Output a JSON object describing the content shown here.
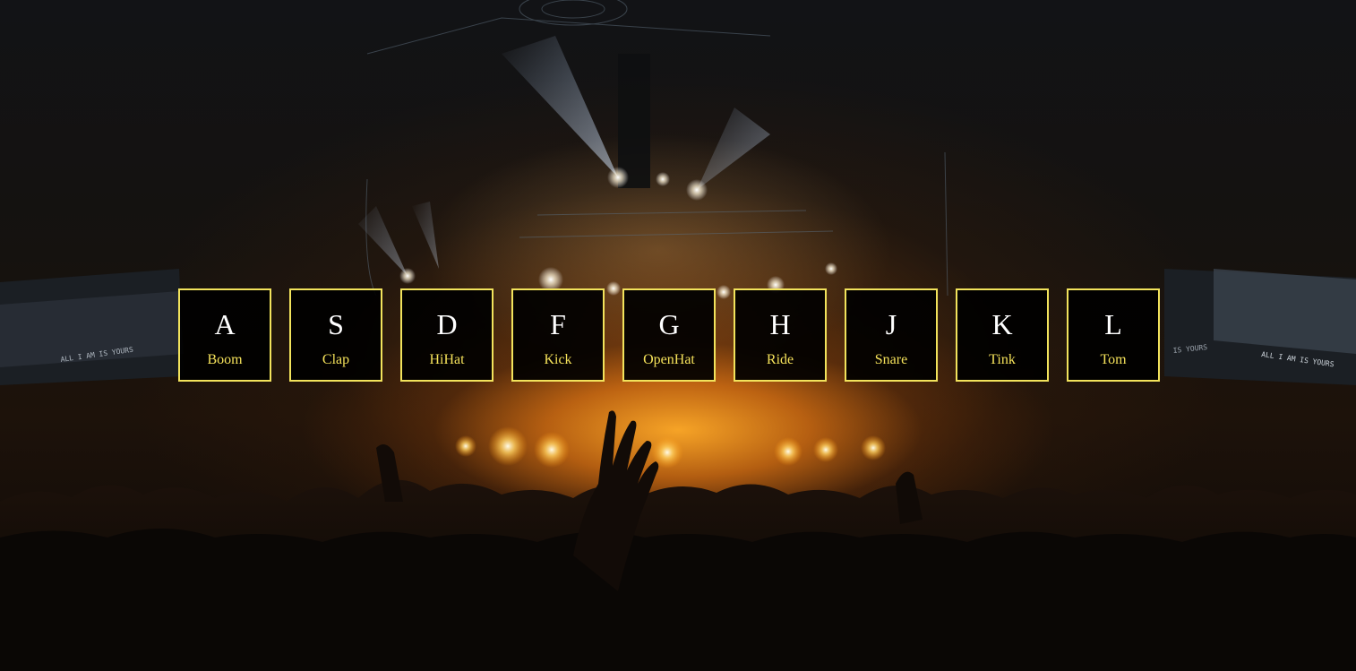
{
  "keys": [
    {
      "key": "A",
      "sound": "Boom"
    },
    {
      "key": "S",
      "sound": "Clap"
    },
    {
      "key": "D",
      "sound": "HiHat"
    },
    {
      "key": "F",
      "sound": "Kick"
    },
    {
      "key": "G",
      "sound": "OpenHat"
    },
    {
      "key": "H",
      "sound": "Ride"
    },
    {
      "key": "J",
      "sound": "Snare"
    },
    {
      "key": "K",
      "sound": "Tink"
    },
    {
      "key": "L",
      "sound": "Tom"
    }
  ],
  "background": {
    "screen_left_text": "ALL I AM IS YOURS",
    "screen_right_text": "ALL I AM IS YOURS",
    "screen_right_partial_text": "IS YOURS"
  },
  "colors": {
    "key_border": "#f2e35c",
    "key_background": "#000000",
    "key_letter": "#ffffff",
    "sound_label": "#f5e25a"
  }
}
